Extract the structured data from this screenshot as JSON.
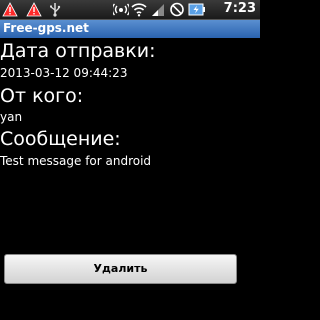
{
  "status_bar": {
    "time": "7:23",
    "icons": [
      "warning-triangle-icon",
      "warning-triangle-icon",
      "usb-icon",
      "gps-signal-icon",
      "wifi-icon",
      "signal-bars-icon",
      "no-sim-icon",
      "battery-charging-icon"
    ],
    "colors": {
      "warning": "#ff2a2a",
      "battery": "#5aa0e6"
    }
  },
  "title_bar": {
    "title": "Free-gps.net",
    "color": "#3b74c0"
  },
  "message": {
    "sent_label": "Дата отправки:",
    "sent_value": "2013-03-12 09:44:23",
    "from_label": "От кого:",
    "from_value": "yan",
    "body_label": "Сообщение:",
    "body_value": "Test message for android"
  },
  "actions": {
    "delete_label": "Удалить"
  }
}
